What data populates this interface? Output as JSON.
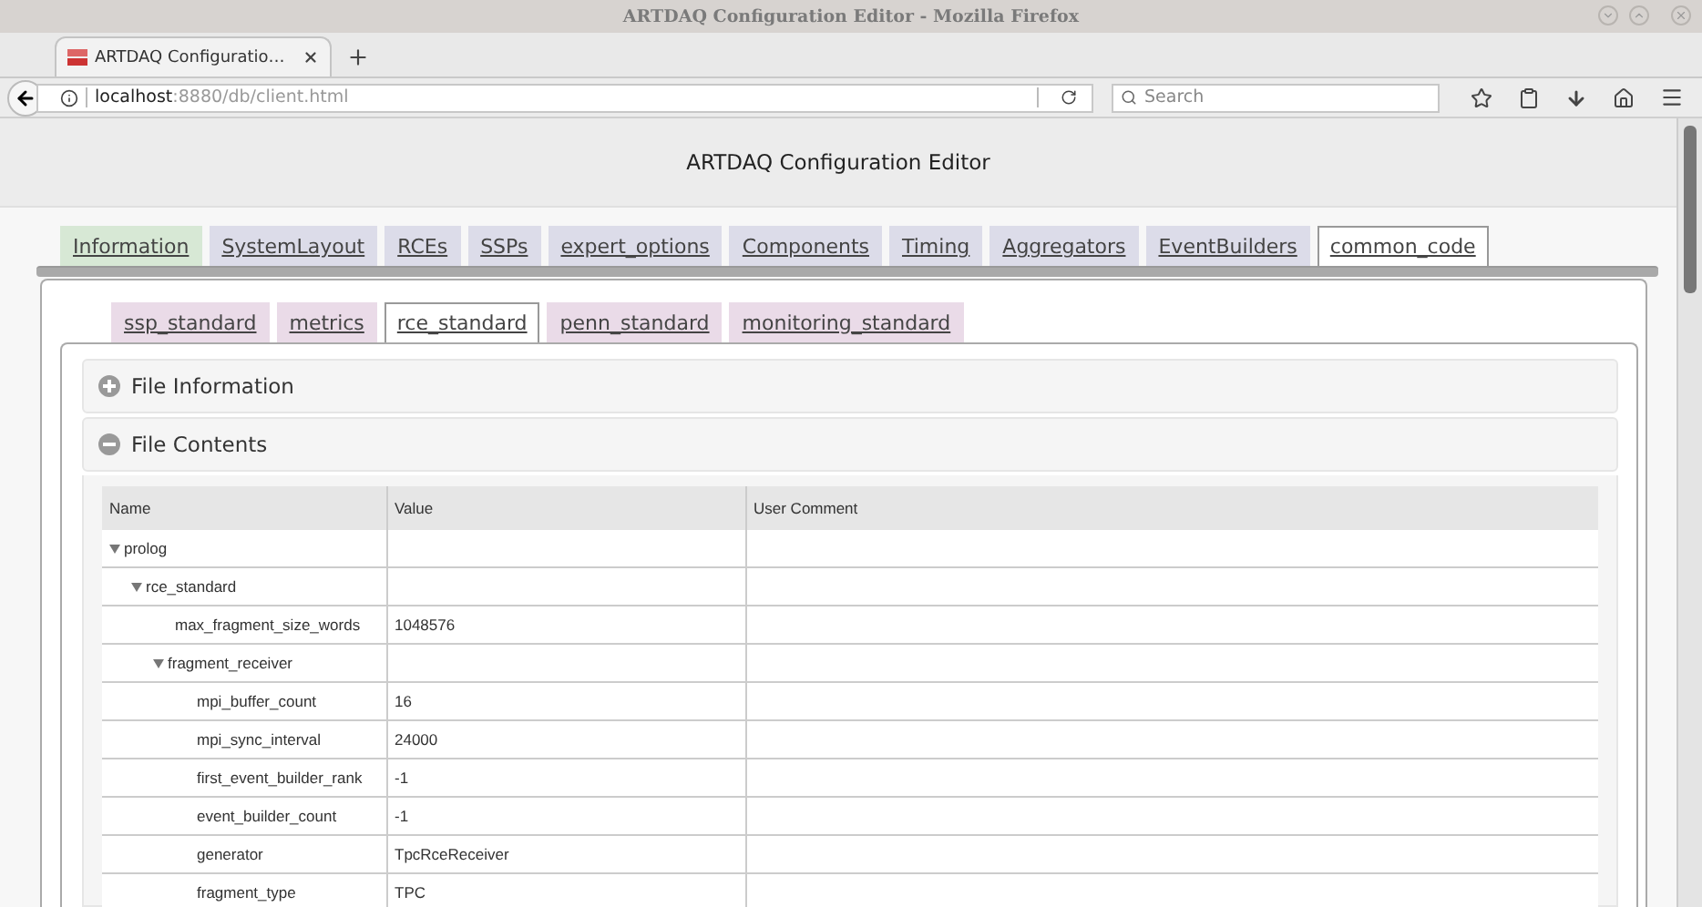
{
  "window": {
    "title": "ARTDAQ Configuration Editor - Mozilla Firefox"
  },
  "browser_tab": {
    "title": "ARTDAQ Configuratio…"
  },
  "address_bar": {
    "host": "localhost",
    "path": ":8880/db/client.html"
  },
  "search": {
    "placeholder": "Search"
  },
  "page": {
    "heading": "ARTDAQ Configuration Editor"
  },
  "main_tabs": [
    {
      "label": "Information",
      "kind": "info",
      "selected": false
    },
    {
      "label": "SystemLayout",
      "kind": "config",
      "selected": false
    },
    {
      "label": "RCEs",
      "kind": "config",
      "selected": false
    },
    {
      "label": "SSPs",
      "kind": "config",
      "selected": false
    },
    {
      "label": "expert_options",
      "kind": "config",
      "selected": false
    },
    {
      "label": "Components",
      "kind": "config",
      "selected": false
    },
    {
      "label": "Timing",
      "kind": "config",
      "selected": false
    },
    {
      "label": "Aggregators",
      "kind": "config",
      "selected": false
    },
    {
      "label": "EventBuilders",
      "kind": "config",
      "selected": false
    },
    {
      "label": "common_code",
      "kind": "config",
      "selected": true
    }
  ],
  "sub_tabs": [
    {
      "label": "ssp_standard",
      "selected": false
    },
    {
      "label": "metrics",
      "selected": false
    },
    {
      "label": "rce_standard",
      "selected": true
    },
    {
      "label": "penn_standard",
      "selected": false
    },
    {
      "label": "monitoring_standard",
      "selected": false
    }
  ],
  "sections": [
    {
      "title": "File Information",
      "expanded": false
    },
    {
      "title": "File Contents",
      "expanded": true
    }
  ],
  "table": {
    "columns": [
      "Name",
      "Value",
      "User Comment"
    ],
    "rows": [
      {
        "name": "prolog",
        "expanded": true,
        "children": [
          {
            "name": "rce_standard",
            "expanded": true,
            "children": [
              {
                "name": "max_fragment_size_words",
                "value": "1048576"
              },
              {
                "name": "fragment_receiver",
                "expanded": true,
                "children": [
                  {
                    "name": "mpi_buffer_count",
                    "value": "16"
                  },
                  {
                    "name": "mpi_sync_interval",
                    "value": "24000"
                  },
                  {
                    "name": "first_event_builder_rank",
                    "value": "-1"
                  },
                  {
                    "name": "event_builder_count",
                    "value": "-1"
                  },
                  {
                    "name": "generator",
                    "value": "TpcRceReceiver"
                  },
                  {
                    "name": "fragment_type",
                    "value": "TPC"
                  }
                ]
              }
            ]
          }
        ]
      }
    ]
  }
}
